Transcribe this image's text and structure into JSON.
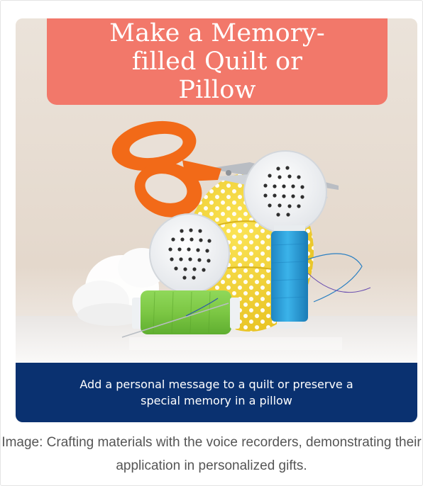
{
  "banner": {
    "title": "Make a Memory-filled Quilt or Pillow",
    "caption": "Add a personal message to a quilt or preserve a special memory in a pillow"
  },
  "figure": {
    "caption": "Image: Crafting materials with the voice recorders, demonstrating their application in personalized gifts."
  },
  "photo_objects": [
    "scissors-icon",
    "voice-recorder-icon",
    "thread-spool-icon",
    "polka-dot-fabric-ball",
    "cotton-stuffing"
  ],
  "colors": {
    "title_bg": "#f2786a",
    "caption_bg": "#0a3170",
    "scissors_handle": "#f26a18",
    "green_thread": "#7fcb4a",
    "blue_thread": "#2aa2dc",
    "fabric_yellow": "#f6d939"
  }
}
